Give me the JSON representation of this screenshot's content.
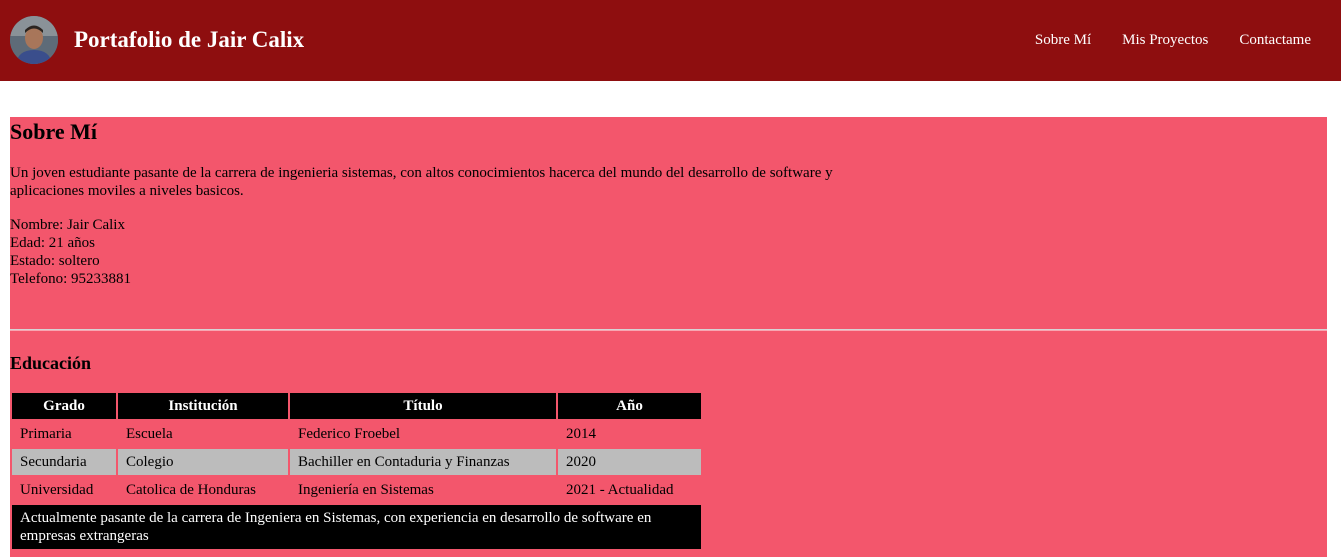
{
  "header": {
    "brand": "Portafolio de Jair Calix",
    "nav": [
      "Sobre Mí",
      "Mis Proyectos",
      "Contactame"
    ],
    "colors": {
      "background": "#8e0e0f",
      "text": "#ffffff"
    }
  },
  "about": {
    "title": "Sobre Mí",
    "description": "Un joven estudiante pasante de la carrera de ingenieria sistemas, con altos conocimientos hacerca del mundo del desarrollo de software y aplicaciones moviles a niveles basicos.",
    "info": [
      "Nombre: Jair Calix",
      "Edad: 21 años",
      "Estado: soltero",
      "Telefono: 95233881"
    ],
    "colors": {
      "panel": "#f3566c"
    }
  },
  "education": {
    "title": "Educación",
    "headers": [
      "Grado",
      "Institución",
      "Título",
      "Año"
    ],
    "rows": [
      [
        "Primaria",
        "Escuela",
        "Federico Froebel",
        "2014"
      ],
      [
        "Secundaria",
        "Colegio",
        "Bachiller en Contaduria y Finanzas",
        "2020"
      ],
      [
        "Universidad",
        "Catolica de Honduras",
        "Ingeniería en Sistemas",
        "2021 - Actualidad"
      ]
    ],
    "note": "Actualmente pasante de la carrera de Ingeniera en Sistemas, con experiencia en desarrollo de software en empresas extrangeras",
    "colors": {
      "header_bg": "#000000",
      "alt_row_bg": "#bcbcbc"
    }
  }
}
